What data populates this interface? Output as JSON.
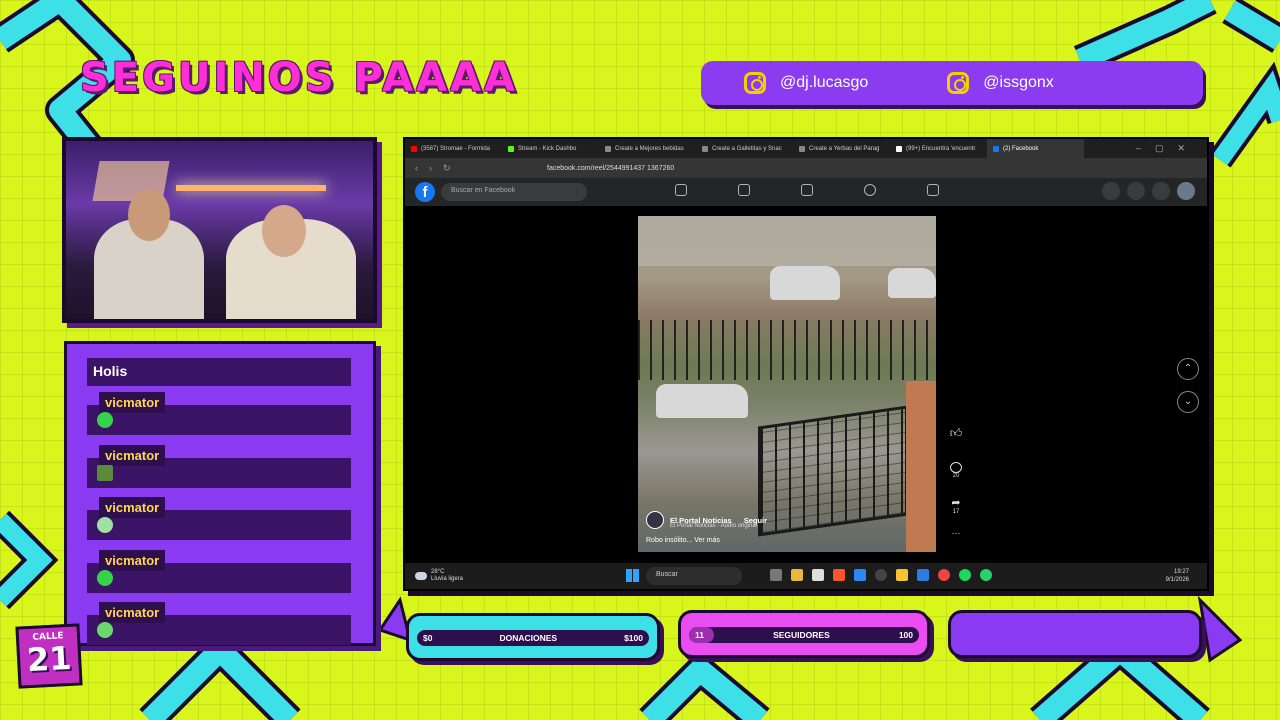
{
  "header": {
    "title": "SEGUINOS PAAAA",
    "socials": [
      {
        "icon": "instagram-icon",
        "handle": "@dj.lucasgo"
      },
      {
        "icon": "instagram-icon",
        "handle": "@issgonx"
      }
    ]
  },
  "chat": {
    "top_message": "Holis",
    "messages": [
      {
        "user": "vicmator",
        "emote_color": "#38d24a"
      },
      {
        "user": "vicmator",
        "emote_color": "#5a8a3a"
      },
      {
        "user": "vicmator",
        "emote_color": "#a0e0a0"
      },
      {
        "user": "vicmator",
        "emote_color": "#38d24a"
      },
      {
        "user": "vicmator",
        "emote_color": "#6bd86b"
      }
    ]
  },
  "logo": {
    "top": "CALLE",
    "number": "21"
  },
  "browser": {
    "tabs": [
      {
        "label": "(3587) Stromae - Formida",
        "color": "#ff0000"
      },
      {
        "label": "Stream - Kick Dashbo",
        "color": "#53fc18"
      },
      {
        "label": "Create a Mejores bebidas",
        "color": "#888"
      },
      {
        "label": "Create a Galletitas y Snac",
        "color": "#888"
      },
      {
        "label": "Create a Yerbas del Parag",
        "color": "#888"
      },
      {
        "label": "(99+) Encuentra 'encuentr",
        "color": "#fff"
      },
      {
        "label": "(2) Facebook",
        "color": "#1877f2",
        "active": true
      }
    ],
    "url": "facebook.com/reel/2544991437 1367260"
  },
  "facebook": {
    "logo": "f",
    "search_placeholder": "Buscar en Facebook",
    "reel": {
      "author": "El Portal Noticias",
      "follow": "Seguir",
      "audio": "El Portal Noticias · Audio original",
      "caption": "Robo insólito... Ver más",
      "comments": "20",
      "shares": "17",
      "more": "···"
    }
  },
  "taskbar": {
    "temp": "28°C",
    "weather": "Lluvia ligera",
    "search": "Buscar",
    "time": "19:27",
    "date": "9/1/2026"
  },
  "bars": {
    "donaciones": {
      "label": "DONACIONES",
      "left": "$0",
      "right": "$100",
      "progress": 0.0
    },
    "seguidores": {
      "label": "SEGUIDORES",
      "left": "11",
      "right": "100",
      "progress": 0.11
    }
  },
  "colors": {
    "background": "#d8f51c",
    "accent_purple": "#8a3af0",
    "accent_pink": "#ff2fd8",
    "accent_cyan": "#3ee0e8",
    "bar_pink": "#e94cf0"
  }
}
